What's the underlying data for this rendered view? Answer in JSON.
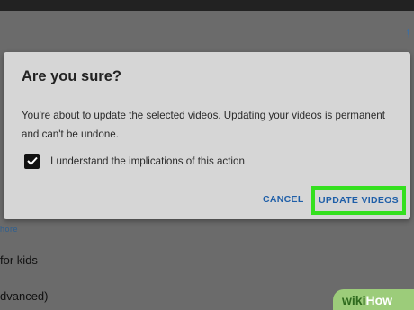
{
  "dialog": {
    "title": "Are you sure?",
    "message": "You're about to update the selected videos. Updating your videos is permanent and can't be undone.",
    "checkbox_label": "I understand the implications of this action",
    "checkbox_checked": true,
    "cancel_label": "CANCEL",
    "confirm_label": "UPDATE VIDEOS"
  },
  "background": {
    "link_fragment": "hore",
    "row1_text": "for kids",
    "row2_text": "dvanced)"
  },
  "watermark": {
    "prefix": "wiki",
    "suffix": "How"
  },
  "colors": {
    "accent": "#1f5fa8",
    "highlight": "#34e01f",
    "dialog_bg": "#d6d6d6",
    "checkbox": "#111111"
  }
}
